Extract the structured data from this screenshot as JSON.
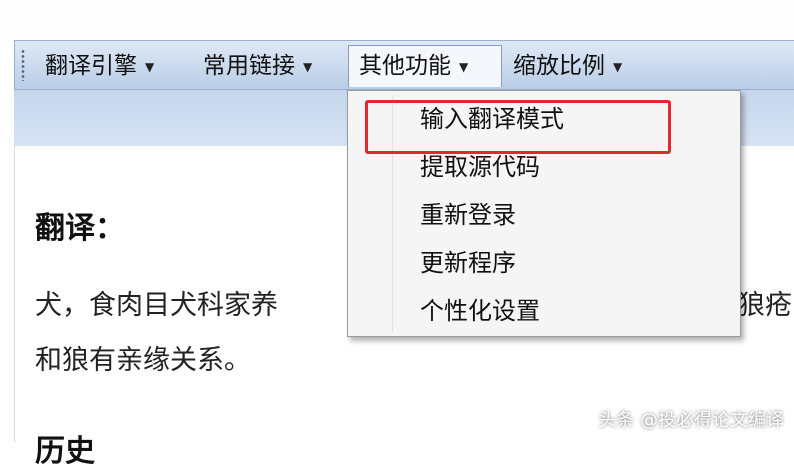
{
  "menubar": {
    "items": [
      {
        "label": "翻译引擎"
      },
      {
        "label": "常用链接"
      },
      {
        "label": "其他功能"
      },
      {
        "label": "缩放比例"
      }
    ]
  },
  "dropdown": {
    "items": [
      {
        "label": "输入翻译模式"
      },
      {
        "label": "提取源代码"
      },
      {
        "label": "重新登录"
      },
      {
        "label": "更新程序"
      },
      {
        "label": "个性化设置"
      }
    ]
  },
  "content": {
    "heading": "翻译：",
    "line1_left": "犬，食肉目犬科家养",
    "line1_right": "狼疮",
    "line2": "和狼有亲缘关系。",
    "heading2": "历史"
  },
  "watermark": "头条 @投必得论文编译",
  "colors": {
    "highlight_border": "#e0282e",
    "menubar_top": "#dfe9f6",
    "menubar_bottom": "#b9cde6"
  }
}
